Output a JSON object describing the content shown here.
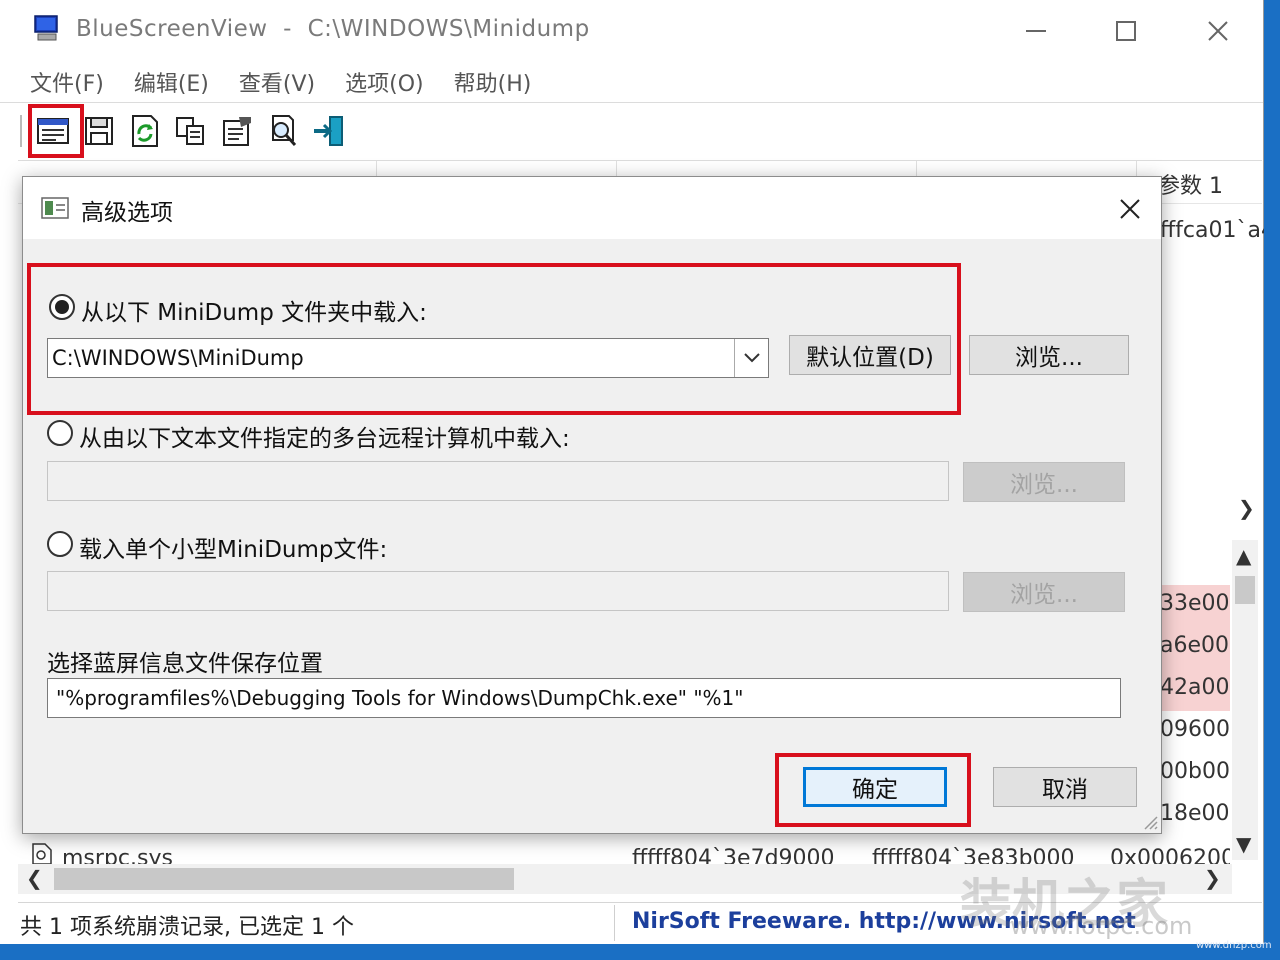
{
  "window": {
    "title": "BlueScreenView  -  C:\\WINDOWS\\Minidump",
    "minimize_icon": "minimize-icon",
    "maximize_icon": "maximize-icon",
    "close_icon": "close-icon"
  },
  "menu": [
    "文件(F)",
    "编辑(E)",
    "查看(V)",
    "选项(O)",
    "帮助(H)"
  ],
  "toolbar": {
    "icons": [
      "advanced-options-icon",
      "save-icon",
      "refresh-icon",
      "copy-icon",
      "properties-icon",
      "find-icon",
      "exit-icon"
    ]
  },
  "background_list": {
    "visible_column_header": "参数 1",
    "visible_cell": "fffca01`a4",
    "lower_pane_values": [
      "33e00",
      "a6e00",
      "42a00",
      "09600",
      "00b00",
      "18e00"
    ],
    "bottom_row": {
      "name": "msrpc.sys",
      "address1": "fffff804`3e7d9000",
      "address2": "fffff804`3e83b000",
      "size": "0x0006200"
    }
  },
  "status": {
    "summary": "共 1 项系统崩溃记录, 已选定 1 个",
    "link": "NirSoft Freeware.  http://www.nirsoft.net"
  },
  "watermark": {
    "text": "装机之家",
    "url": "www.lotpc.com",
    "corner": "www.dnzp.com"
  },
  "dialog": {
    "title": "高级选项",
    "option1": {
      "label": "从以下 MiniDump 文件夹中载入:",
      "checked": true,
      "value": "C:\\WINDOWS\\MiniDump",
      "default_button": "默认位置(D)",
      "browse_button": "浏览..."
    },
    "option2": {
      "label": "从由以下文本文件指定的多台远程计算机中载入:",
      "checked": false,
      "value": "",
      "browse_button": "浏览..."
    },
    "option3": {
      "label": "载入单个小型MiniDump文件:",
      "checked": false,
      "value": "",
      "browse_button": "浏览..."
    },
    "save_label": "选择蓝屏信息文件保存位置",
    "save_value": "\"%programfiles%\\Debugging Tools for Windows\\DumpChk.exe\" \"%1\"",
    "ok": "确定",
    "cancel": "取消"
  },
  "highlight_color": "#d80f1c"
}
